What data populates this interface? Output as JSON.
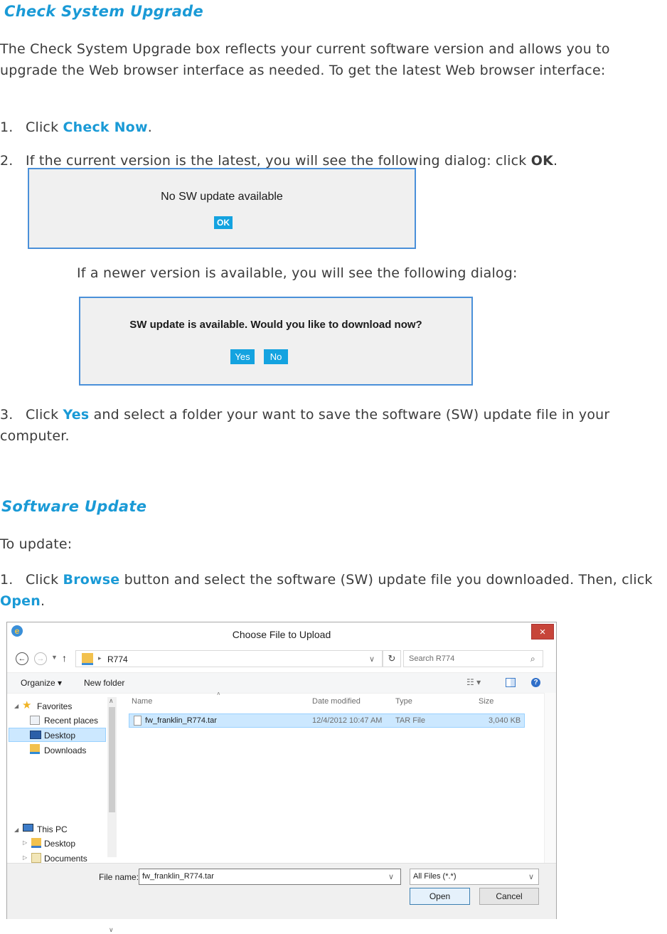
{
  "section1": {
    "title": "Check System Upgrade",
    "intro": "The Check System Upgrade box reflects your current software version and allows you to upgrade the Web browser interface as needed.  To get the latest Web browser interface:",
    "step1": {
      "num": "1.",
      "pre": "Click ",
      "link": "Check Now",
      "post": "."
    },
    "step2": {
      "num": "2.",
      "pre": "If the current version is the latest, you will see the following dialog: click ",
      "bold": "OK",
      "post": "."
    },
    "dialog1": {
      "message": "No SW update available",
      "ok": "OK"
    },
    "newer_text": "If a newer version is available, you will see the following dialog:",
    "dialog2": {
      "message": "SW update is available. Would you like to download now?",
      "yes": "Yes",
      "no": "No"
    },
    "step3": {
      "num": "3.",
      "pre": "Click ",
      "link": "Yes",
      "post": " and select a folder your want to save the software (SW) update file in your computer."
    }
  },
  "section2": {
    "title": "Software Update",
    "intro": "To update:",
    "step1": {
      "num": "1.",
      "pre": "Click ",
      "link": "Browse",
      "mid": " button and select the software (SW) update file you downloaded. Then, click ",
      "link2": "Open",
      "post": "."
    }
  },
  "file_dialog": {
    "title": "Choose File to Upload",
    "close": "×",
    "address": {
      "path": "R774",
      "search_placeholder": "Search R774"
    },
    "toolbar": {
      "organize": "Organize ▾",
      "new_folder": "New folder"
    },
    "nav": {
      "favorites": "Favorites",
      "items": [
        "Recent places",
        "Desktop",
        "Downloads"
      ],
      "this_pc": "This PC",
      "pc_items": [
        "Desktop",
        "Documents"
      ]
    },
    "columns": {
      "name": "Name",
      "date": "Date modified",
      "type": "Type",
      "size": "Size"
    },
    "files": [
      {
        "name": "fw_franklin_R774.tar",
        "date": "12/4/2012 10:47 AM",
        "type": "TAR File",
        "size": "3,040 KB"
      }
    ],
    "filename_label": "File name:",
    "filename_value": "fw_franklin_R774.tar",
    "filter": "All Files (*.*)",
    "open": "Open",
    "cancel": "Cancel"
  },
  "colors": {
    "accent": "#1a9ad6",
    "button_blue": "#14a3e0",
    "dialog_border": "#4a90d9"
  }
}
